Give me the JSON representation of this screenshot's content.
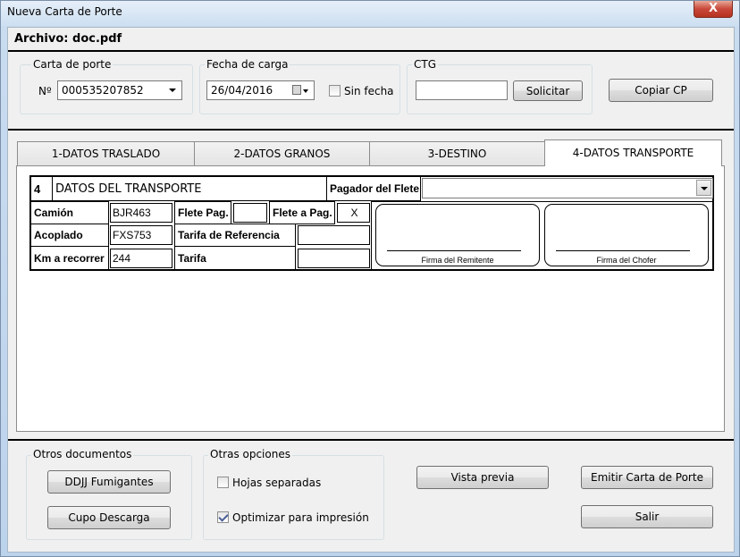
{
  "window": {
    "title": "Nueva Carta de Porte",
    "close_glyph": "X"
  },
  "archivo": "Archivo: doc.pdf",
  "carta_porte": {
    "legend": "Carta de porte",
    "prefix": "Nº",
    "value": "000535207852"
  },
  "fecha_carga": {
    "legend": "Fecha de carga",
    "value": "26/04/2016",
    "sin_fecha_label": "Sin fecha",
    "sin_fecha_checked": false
  },
  "ctg": {
    "legend": "CTG",
    "value": "",
    "solicitar_label": "Solicitar"
  },
  "copiar_cp_label": "Copiar CP",
  "tabs": [
    {
      "label": "1-DATOS TRASLADO",
      "active": false
    },
    {
      "label": "2-DATOS GRANOS",
      "active": false
    },
    {
      "label": "3-DESTINO",
      "active": false
    },
    {
      "label": "4-DATOS TRANSPORTE",
      "active": true
    }
  ],
  "transporte": {
    "section_number": "4",
    "section_title": "DATOS DEL TRANSPORTE",
    "pagador_label": "Pagador del Flete",
    "pagador_value": "",
    "camion_label": "Camión",
    "camion_value": "BJR463",
    "acoplado_label": "Acoplado",
    "acoplado_value": "FXS753",
    "km_label": "Km a recorrer",
    "km_value": "244",
    "flete_pag_label": "Flete Pag.",
    "flete_pag_value": "",
    "flete_a_pag_label": "Flete a Pag.",
    "flete_a_pag_value": "X",
    "tarifa_ref_label": "Tarifa de Referencia",
    "tarifa_ref_value": "",
    "tarifa_label": "Tarifa",
    "tarifa_value": "",
    "firma_remitente": "Firma del Remitente",
    "firma_chofer": "Firma del Chofer"
  },
  "otros_documentos": {
    "legend": "Otros documentos",
    "ddjj_label": "DDJJ Fumigantes",
    "cupo_label": "Cupo Descarga"
  },
  "otras_opciones": {
    "legend": "Otras opciones",
    "hojas_label": "Hojas separadas",
    "hojas_checked": false,
    "optimizar_label": "Optimizar para impresión",
    "optimizar_checked": true
  },
  "actions": {
    "vista_previa": "Vista previa",
    "emitir": "Emitir Carta de Porte",
    "salir": "Salir"
  }
}
